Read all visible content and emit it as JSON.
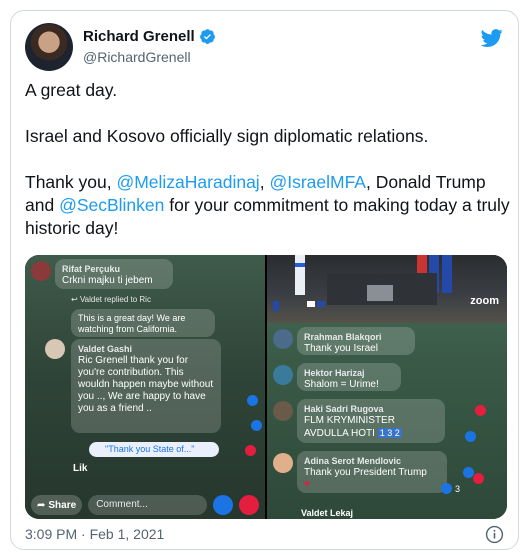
{
  "author": {
    "display_name": "Richard Grenell",
    "handle": "@RichardGrenell"
  },
  "tweet": {
    "line1": "A great day.",
    "line2": "Israel and Kosovo officially sign diplomatic relations.",
    "thanks_prefix": "Thank you, ",
    "mention1": "@MelizaHaradinaj",
    "sep1": ", ",
    "mention2": "@IsraelMFA",
    "thanks_mid": ", Donald Trump and ",
    "mention3": "@SecBlinken",
    "thanks_suffix": " for your commitment to making today a truly historic day!"
  },
  "media": {
    "left": {
      "c1_author": "Rifat Perçuku",
      "c1_text": "Crkni majku ti jebem",
      "reply_note": "Valdet replied to Ric",
      "c2_text": "This is a great day! We are watching from California.",
      "c3_author": "Valdet Gashi",
      "c3_text": "Ric Grenell thank you for you're contribution. This wouldn happen maybe without you .., We are happy to have you as a friend ..",
      "chip_text": "\"Thank you State of...\"",
      "partial_author": "Lik",
      "share_label": "Share",
      "comment_placeholder": "Comment..."
    },
    "right": {
      "zoom_label": "zoom",
      "r1_author": "Rrahman Blakqori",
      "r1_text": "Thank you Israel",
      "r2_author": "Hektor Harizaj",
      "r2_text": "Shalom = Urime!",
      "r3_author": "Haki Sadri Rugova",
      "r3_line1": "FLM KRYMINISTER",
      "r3_line2": "AVDULLA HOTI",
      "r3_badges": "1 3 2",
      "r4_author": "Adina Serot Mendlovic",
      "r4_text": "Thank you President Trump",
      "r4_count": "3",
      "r5_author": "Valdet Lekaj"
    }
  },
  "footer": {
    "timestamp": "3:09 PM · Feb 1, 2021"
  },
  "colors": {
    "twitter_blue": "#1d9bf0",
    "facebook_blue": "#1b74e4",
    "love_red": "#e41e3f"
  }
}
